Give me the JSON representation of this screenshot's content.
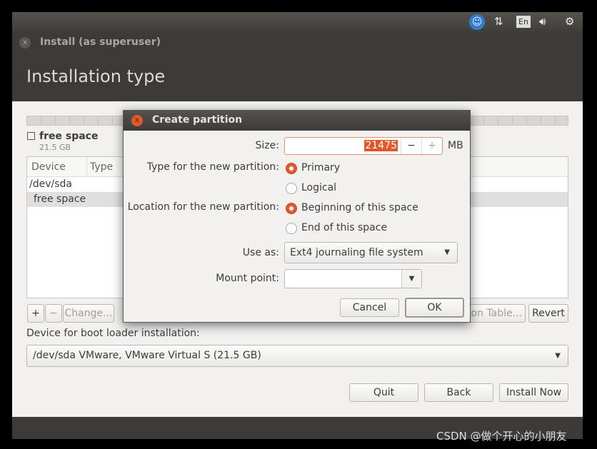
{
  "top_panel": {
    "icons": [
      "accessibility-icon",
      "network-icon",
      "keyboard-layout-icon",
      "volume-icon",
      "power-gear-icon"
    ],
    "keyboard_layout": "En"
  },
  "window": {
    "title": "Install (as superuser)",
    "heading": "Installation type"
  },
  "partition_bar": {
    "entry_label": "free space",
    "entry_size": "21.5 GB"
  },
  "table": {
    "columns": [
      "Device",
      "Type"
    ],
    "rows": [
      "/dev/sda",
      "free space"
    ]
  },
  "table_buttons": {
    "add": "+",
    "remove": "−",
    "change": "Change...",
    "new_table": "ion Table...",
    "revert": "Revert"
  },
  "boot_loader": {
    "label": "Device for boot loader installation:",
    "value": "/dev/sda VMware, VMware Virtual S (21.5 GB)"
  },
  "nav_buttons": {
    "quit": "Quit",
    "back": "Back",
    "install": "Install Now"
  },
  "dialog": {
    "title": "Create partition",
    "size_label": "Size:",
    "size_value": "21475",
    "size_unit": "MB",
    "decrement": "−",
    "increment": "+",
    "type_label": "Type for the new partition:",
    "type_options": [
      "Primary",
      "Logical"
    ],
    "type_selected": "Primary",
    "location_label": "Location for the new partition:",
    "location_options": [
      "Beginning of this space",
      "End of this space"
    ],
    "location_selected": "Beginning of this space",
    "use_as_label": "Use as:",
    "use_as_value": "Ext4 journaling file system",
    "mount_label": "Mount point:",
    "mount_value": "",
    "cancel": "Cancel",
    "ok": "OK"
  },
  "watermark": "CSDN @做个开心的小朋友",
  "colors": {
    "accent": "#e0582a",
    "panel": "#3d3b37",
    "content": "#f2f1f0"
  }
}
